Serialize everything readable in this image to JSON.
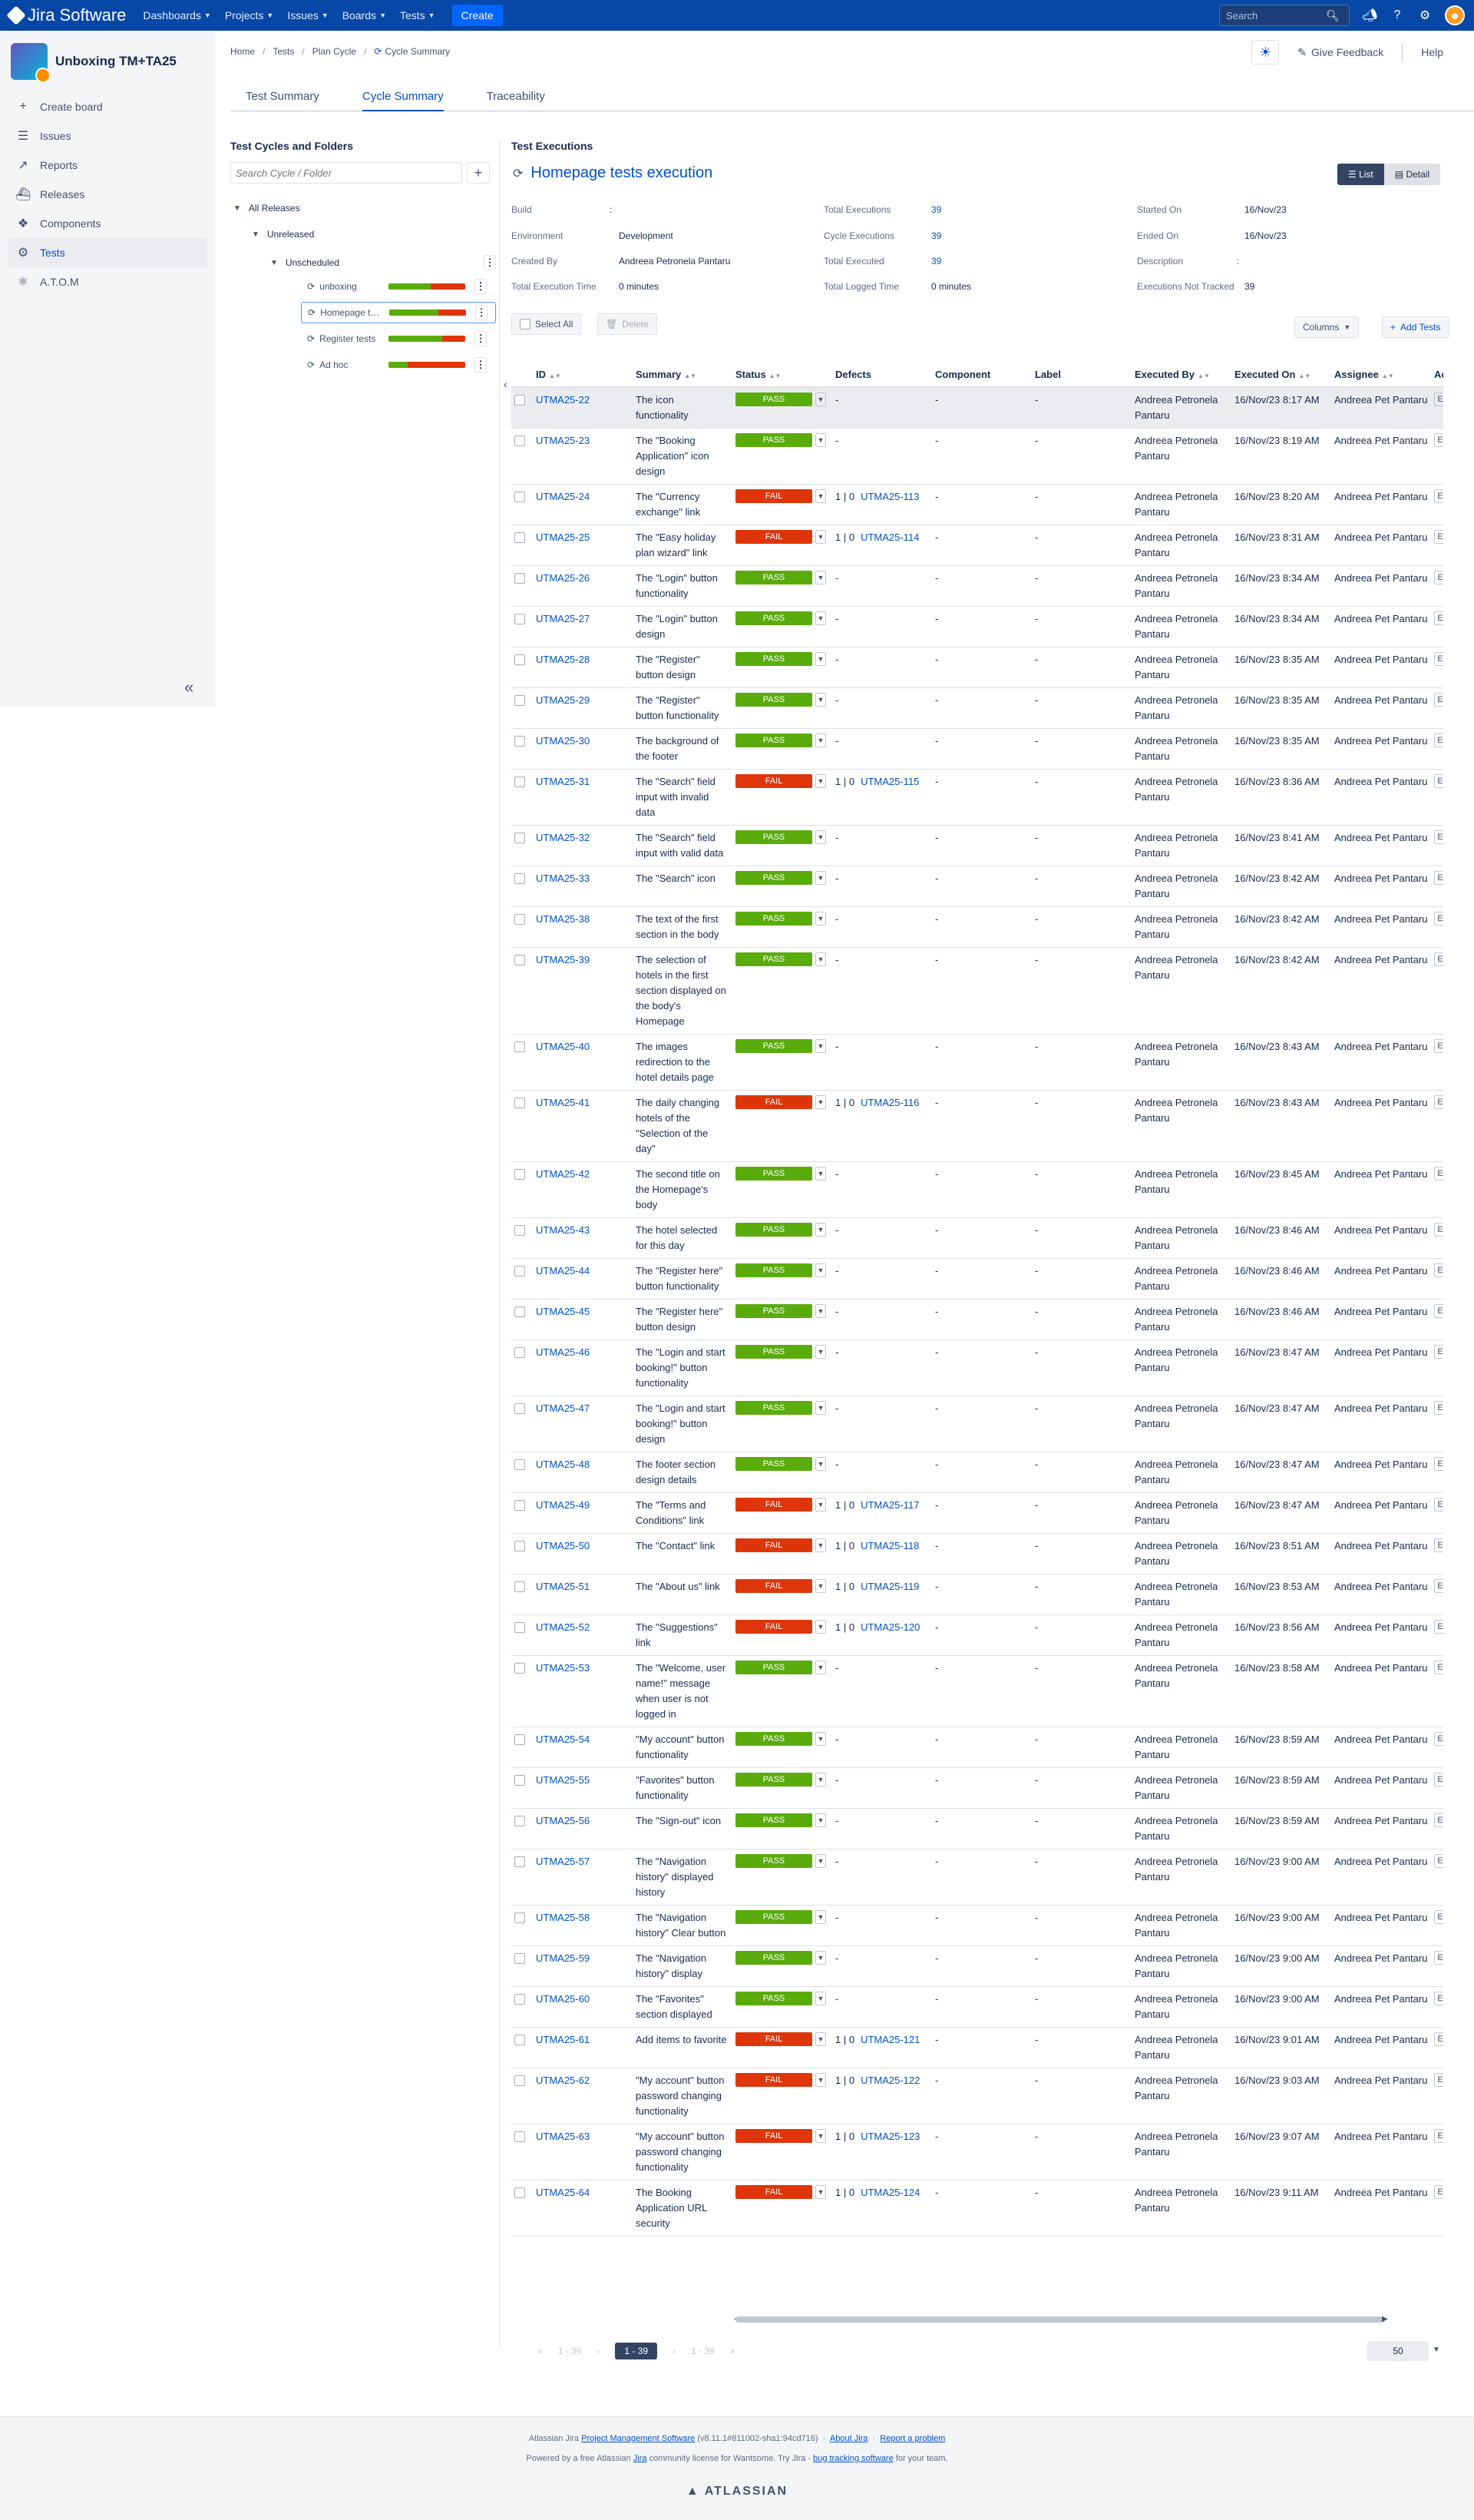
{
  "topnav": {
    "product": "Jira Software",
    "menus": [
      "Dashboards",
      "Projects",
      "Issues",
      "Boards",
      "Tests"
    ],
    "create_label": "Create",
    "search_placeholder": "Search"
  },
  "sidebar": {
    "project_name": "Unboxing TM+TA25",
    "items": [
      {
        "label": "Create board",
        "icon": "plus-icon"
      },
      {
        "label": "Issues",
        "icon": "issues-icon"
      },
      {
        "label": "Reports",
        "icon": "reports-icon"
      },
      {
        "label": "Releases",
        "icon": "releases-icon"
      },
      {
        "label": "Components",
        "icon": "components-icon"
      },
      {
        "label": "Tests",
        "icon": "tests-icon"
      },
      {
        "label": "A.T.O.M",
        "icon": "atom-icon"
      }
    ]
  },
  "breadcrumb": [
    "Home",
    "Tests",
    "Plan Cycle",
    "Cycle Summary"
  ],
  "header": {
    "feedback_label": "Give Feedback",
    "help_label": "Help"
  },
  "tabs": [
    "Test Summary",
    "Cycle Summary",
    "Traceability"
  ],
  "tree": {
    "title": "Test Cycles and Folders",
    "search_placeholder": "Search Cycle / Folder",
    "all_releases": "All Releases",
    "unreleased": "Unreleased",
    "unscheduled": "Unscheduled",
    "cycles": [
      {
        "name": "unboxing",
        "pass": 0.55,
        "fail": 0.45
      },
      {
        "name": "Homepage tests execution",
        "pass": 0.64,
        "fail": 0.36
      },
      {
        "name": "Register tests",
        "pass": 0.7,
        "fail": 0.3
      },
      {
        "name": "Ad hoc",
        "pass": 0.25,
        "fail": 0.75
      }
    ]
  },
  "executions": {
    "section_title": "Test Executions",
    "cycle_name": "Homepage tests execution",
    "view_list": "List",
    "view_detail": "Detail",
    "meta": {
      "build_label": "Build",
      "build": ":",
      "environment_label": "Environment",
      "environment": "Development",
      "created_by_label": "Created By",
      "created_by": "Andreea Petronela Pantaru",
      "total_time_label": "Total Execution Time",
      "total_time": "0 minutes",
      "total_exec_label": "Total Executions",
      "total_exec": "39",
      "cycle_exec_label": "Cycle Executions",
      "cycle_exec": "39",
      "total_executed_label": "Total Executed",
      "total_executed": "39",
      "logged_label": "Total Logged Time",
      "logged": "0 minutes",
      "started_label": "Started On",
      "started": "16/Nov/23",
      "ended_label": "Ended On",
      "ended": "16/Nov/23",
      "description_label": "Description",
      "description": ":",
      "not_tracked_label": "Executions Not Tracked",
      "not_tracked": "39"
    },
    "select_all": "Select All",
    "delete": "Delete",
    "columns": "Columns",
    "add_tests": "Add Tests"
  },
  "table": {
    "headers": [
      "ID",
      "Summary",
      "Status",
      "Defects",
      "Component",
      "Label",
      "Executed By",
      "Executed On",
      "Assignee",
      "Actions"
    ],
    "rows": [
      {
        "id": "UTMA25-22",
        "summary": "The icon functionality",
        "status": "PASS",
        "defect": "",
        "on": "16/Nov/23 8:17 AM"
      },
      {
        "id": "UTMA25-23",
        "summary": "The \"Booking Application\" icon design",
        "status": "PASS",
        "defect": "",
        "on": "16/Nov/23 8:19 AM"
      },
      {
        "id": "UTMA25-24",
        "summary": "The \"Currency exchange\" link",
        "status": "FAIL",
        "defect": "UTMA25-113",
        "on": "16/Nov/23 8:20 AM"
      },
      {
        "id": "UTMA25-25",
        "summary": "The \"Easy holiday plan wizard\" link",
        "status": "FAIL",
        "defect": "UTMA25-114",
        "on": "16/Nov/23 8:31 AM"
      },
      {
        "id": "UTMA25-26",
        "summary": "The \"Login\" button functionality",
        "status": "PASS",
        "defect": "",
        "on": "16/Nov/23 8:34 AM"
      },
      {
        "id": "UTMA25-27",
        "summary": "The \"Login\" button design",
        "status": "PASS",
        "defect": "",
        "on": "16/Nov/23 8:34 AM"
      },
      {
        "id": "UTMA25-28",
        "summary": "The \"Register\" button design",
        "status": "PASS",
        "defect": "",
        "on": "16/Nov/23 8:35 AM"
      },
      {
        "id": "UTMA25-29",
        "summary": "The \"Register\" button functionality",
        "status": "PASS",
        "defect": "",
        "on": "16/Nov/23 8:35 AM"
      },
      {
        "id": "UTMA25-30",
        "summary": "The background of the footer",
        "status": "PASS",
        "defect": "",
        "on": "16/Nov/23 8:35 AM"
      },
      {
        "id": "UTMA25-31",
        "summary": "The \"Search\" field input with invalid data",
        "status": "FAIL",
        "defect": "UTMA25-115",
        "on": "16/Nov/23 8:36 AM"
      },
      {
        "id": "UTMA25-32",
        "summary": "The \"Search\" field input with valid data",
        "status": "PASS",
        "defect": "",
        "on": "16/Nov/23 8:41 AM"
      },
      {
        "id": "UTMA25-33",
        "summary": "The \"Search\" icon",
        "status": "PASS",
        "defect": "",
        "on": "16/Nov/23 8:42 AM"
      },
      {
        "id": "UTMA25-38",
        "summary": "The text of the first section in the body",
        "status": "PASS",
        "defect": "",
        "on": "16/Nov/23 8:42 AM"
      },
      {
        "id": "UTMA25-39",
        "summary": "The selection of hotels in the first section displayed on the body's Homepage",
        "status": "PASS",
        "defect": "",
        "on": "16/Nov/23 8:42 AM"
      },
      {
        "id": "UTMA25-40",
        "summary": "The images redirection to the hotel details page",
        "status": "PASS",
        "defect": "",
        "on": "16/Nov/23 8:43 AM"
      },
      {
        "id": "UTMA25-41",
        "summary": "The daily changing hotels of the \"Selection of the day\"",
        "status": "FAIL",
        "defect": "UTMA25-116",
        "on": "16/Nov/23 8:43 AM"
      },
      {
        "id": "UTMA25-42",
        "summary": "The second title on the Homepage's body",
        "status": "PASS",
        "defect": "",
        "on": "16/Nov/23 8:45 AM"
      },
      {
        "id": "UTMA25-43",
        "summary": "The hotel selected for this day",
        "status": "PASS",
        "defect": "",
        "on": "16/Nov/23 8:46 AM"
      },
      {
        "id": "UTMA25-44",
        "summary": "The \"Register here\" button functionality",
        "status": "PASS",
        "defect": "",
        "on": "16/Nov/23 8:46 AM"
      },
      {
        "id": "UTMA25-45",
        "summary": "The \"Register here\" button design",
        "status": "PASS",
        "defect": "",
        "on": "16/Nov/23 8:46 AM"
      },
      {
        "id": "UTMA25-46",
        "summary": "The \"Login and start booking!\" button functionality",
        "status": "PASS",
        "defect": "",
        "on": "16/Nov/23 8:47 AM"
      },
      {
        "id": "UTMA25-47",
        "summary": "The \"Login and start booking!\" button design",
        "status": "PASS",
        "defect": "",
        "on": "16/Nov/23 8:47 AM"
      },
      {
        "id": "UTMA25-48",
        "summary": "The footer section design details",
        "status": "PASS",
        "defect": "",
        "on": "16/Nov/23 8:47 AM"
      },
      {
        "id": "UTMA25-49",
        "summary": "The \"Terms and Conditions\" link",
        "status": "FAIL",
        "defect": "UTMA25-117",
        "on": "16/Nov/23 8:47 AM"
      },
      {
        "id": "UTMA25-50",
        "summary": "The \"Contact\" link",
        "status": "FAIL",
        "defect": "UTMA25-118",
        "on": "16/Nov/23 8:51 AM"
      },
      {
        "id": "UTMA25-51",
        "summary": "The \"About us\" link",
        "status": "FAIL",
        "defect": "UTMA25-119",
        "on": "16/Nov/23 8:53 AM"
      },
      {
        "id": "UTMA25-52",
        "summary": "The \"Suggestions\" link",
        "status": "FAIL",
        "defect": "UTMA25-120",
        "on": "16/Nov/23 8:56 AM"
      },
      {
        "id": "UTMA25-53",
        "summary": "The \"Welcome, user name!\" message when user is not logged in",
        "status": "PASS",
        "defect": "",
        "on": "16/Nov/23 8:58 AM"
      },
      {
        "id": "UTMA25-54",
        "summary": "\"My account\" button functionality",
        "status": "PASS",
        "defect": "",
        "on": "16/Nov/23 8:59 AM"
      },
      {
        "id": "UTMA25-55",
        "summary": "\"Favorites\" button functionality",
        "status": "PASS",
        "defect": "",
        "on": "16/Nov/23 8:59 AM"
      },
      {
        "id": "UTMA25-56",
        "summary": "The \"Sign-out\" icon",
        "status": "PASS",
        "defect": "",
        "on": "16/Nov/23 8:59 AM"
      },
      {
        "id": "UTMA25-57",
        "summary": "The \"Navigation history\" displayed history",
        "status": "PASS",
        "defect": "",
        "on": "16/Nov/23 9:00 AM"
      },
      {
        "id": "UTMA25-58",
        "summary": "The \"Navigation history\" Clear button",
        "status": "PASS",
        "defect": "",
        "on": "16/Nov/23 9:00 AM"
      },
      {
        "id": "UTMA25-59",
        "summary": "The \"Navigation history\" display",
        "status": "PASS",
        "defect": "",
        "on": "16/Nov/23 9:00 AM"
      },
      {
        "id": "UTMA25-60",
        "summary": "The \"Favorites\" section displayed",
        "status": "PASS",
        "defect": "",
        "on": "16/Nov/23 9:00 AM"
      },
      {
        "id": "UTMA25-61",
        "summary": "Add items to favorite",
        "status": "FAIL",
        "defect": "UTMA25-121",
        "on": "16/Nov/23 9:01 AM"
      },
      {
        "id": "UTMA25-62",
        "summary": "\"My account\" button password changing functionality",
        "status": "FAIL",
        "defect": "UTMA25-122",
        "on": "16/Nov/23 9:03 AM"
      },
      {
        "id": "UTMA25-63",
        "summary": "\"My account\" button password changing functionality",
        "status": "FAIL",
        "defect": "UTMA25-123",
        "on": "16/Nov/23 9:07 AM"
      },
      {
        "id": "UTMA25-64",
        "summary": "The Booking Application URL security",
        "status": "FAIL",
        "defect": "UTMA25-124",
        "on": "16/Nov/23 9:11 AM"
      }
    ],
    "executed_by": "Andreea Petronela Pantaru",
    "assignee": "Andreea Pet Pantaru",
    "defect_count": "1 | 0",
    "empty": "-"
  },
  "pager": {
    "prev": "1 - 39",
    "current": "1 - 39",
    "next": "1 - 39",
    "page_size": "50"
  },
  "footer": {
    "line1_prefix": "Atlassian Jira",
    "line1_link": "Project Management Software",
    "line1_version": "(v8.11.1#811002-sha1:94cd716)",
    "about": "About Jira",
    "report": "Report a problem",
    "line2_prefix": "Powered by a free Atlassian",
    "line2_jira": "Jira",
    "line2_mid": "community license for Wantsome. Try Jira -",
    "line2_link": "bug tracking software",
    "line2_suffix": "for your team.",
    "brand": "ATLASSIAN"
  }
}
